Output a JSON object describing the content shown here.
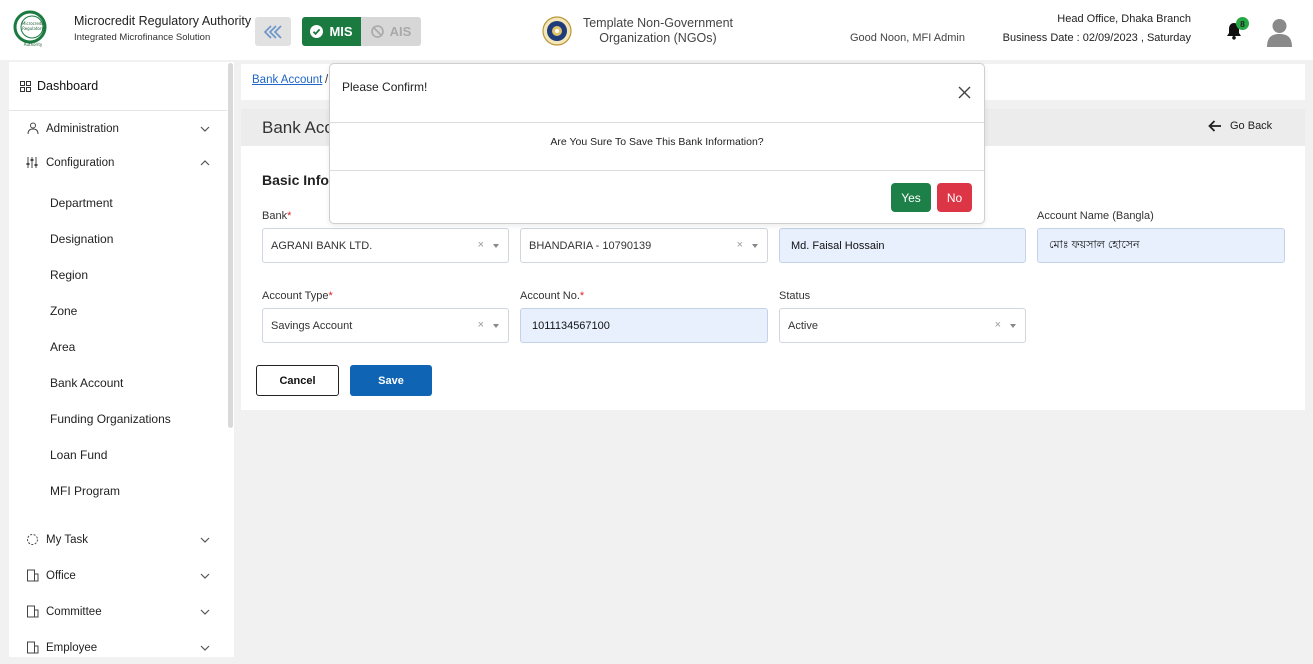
{
  "header": {
    "brand_name": "Microcredit Regulatory Authority",
    "brand_sub": "Integrated Microfinance Solution",
    "logo_text": [
      "Microcredit",
      "Regulatory",
      "Authority"
    ],
    "mis_label": "MIS",
    "ais_label": "AIS",
    "org_name_line1": "Template Non-Government",
    "org_name_line2": "Organization (NGOs)",
    "greeting": "Good Noon, MFI Admin",
    "branch": "Head Office, Dhaka Branch",
    "business_date": "Business Date : 02/09/2023 , Saturday",
    "notification_count": "8"
  },
  "sidebar": {
    "dashboard": "Dashboard",
    "groups": [
      {
        "label": "Administration",
        "expanded": false
      },
      {
        "label": "Configuration",
        "expanded": true
      }
    ],
    "config_items": [
      "Department",
      "Designation",
      "Region",
      "Zone",
      "Area",
      "Bank Account",
      "Funding Organizations",
      "Loan Fund",
      "MFI Program"
    ],
    "more_groups": [
      "My Task",
      "Office",
      "Committee",
      "Employee"
    ]
  },
  "breadcrumb": {
    "link": "Bank Account",
    "sep": "/"
  },
  "page": {
    "title": "Bank Acc",
    "go_back": "Go Back",
    "section_title": "Basic Info"
  },
  "form": {
    "bank_label": "Bank",
    "bank_value": "AGRANI BANK LTD.",
    "branch_value": "BHANDARIA - 10790139",
    "account_name_value": "Md. Faisal Hossain",
    "account_name_bangla_label": "Account Name (Bangla)",
    "account_name_bangla_value": "মোঃ ফয়সাল হোসেন",
    "account_type_label": "Account Type",
    "account_type_value": "Savings Account",
    "account_no_label": "Account No.",
    "account_no_value": "1011134567100",
    "status_label": "Status",
    "status_value": "Active",
    "required_mark": "*",
    "clear_glyph": "×",
    "cancel_label": "Cancel",
    "save_label": "Save"
  },
  "modal": {
    "title": "Please Confirm!",
    "message": "Are You Sure To Save This Bank Information?",
    "yes_label": "Yes",
    "no_label": "No"
  },
  "colors": {
    "mis_green": "#1a7a3f",
    "save_blue": "#0f64b4",
    "yes_green": "#1e8049",
    "no_red": "#dc3545",
    "link_blue": "#1f66c8"
  }
}
